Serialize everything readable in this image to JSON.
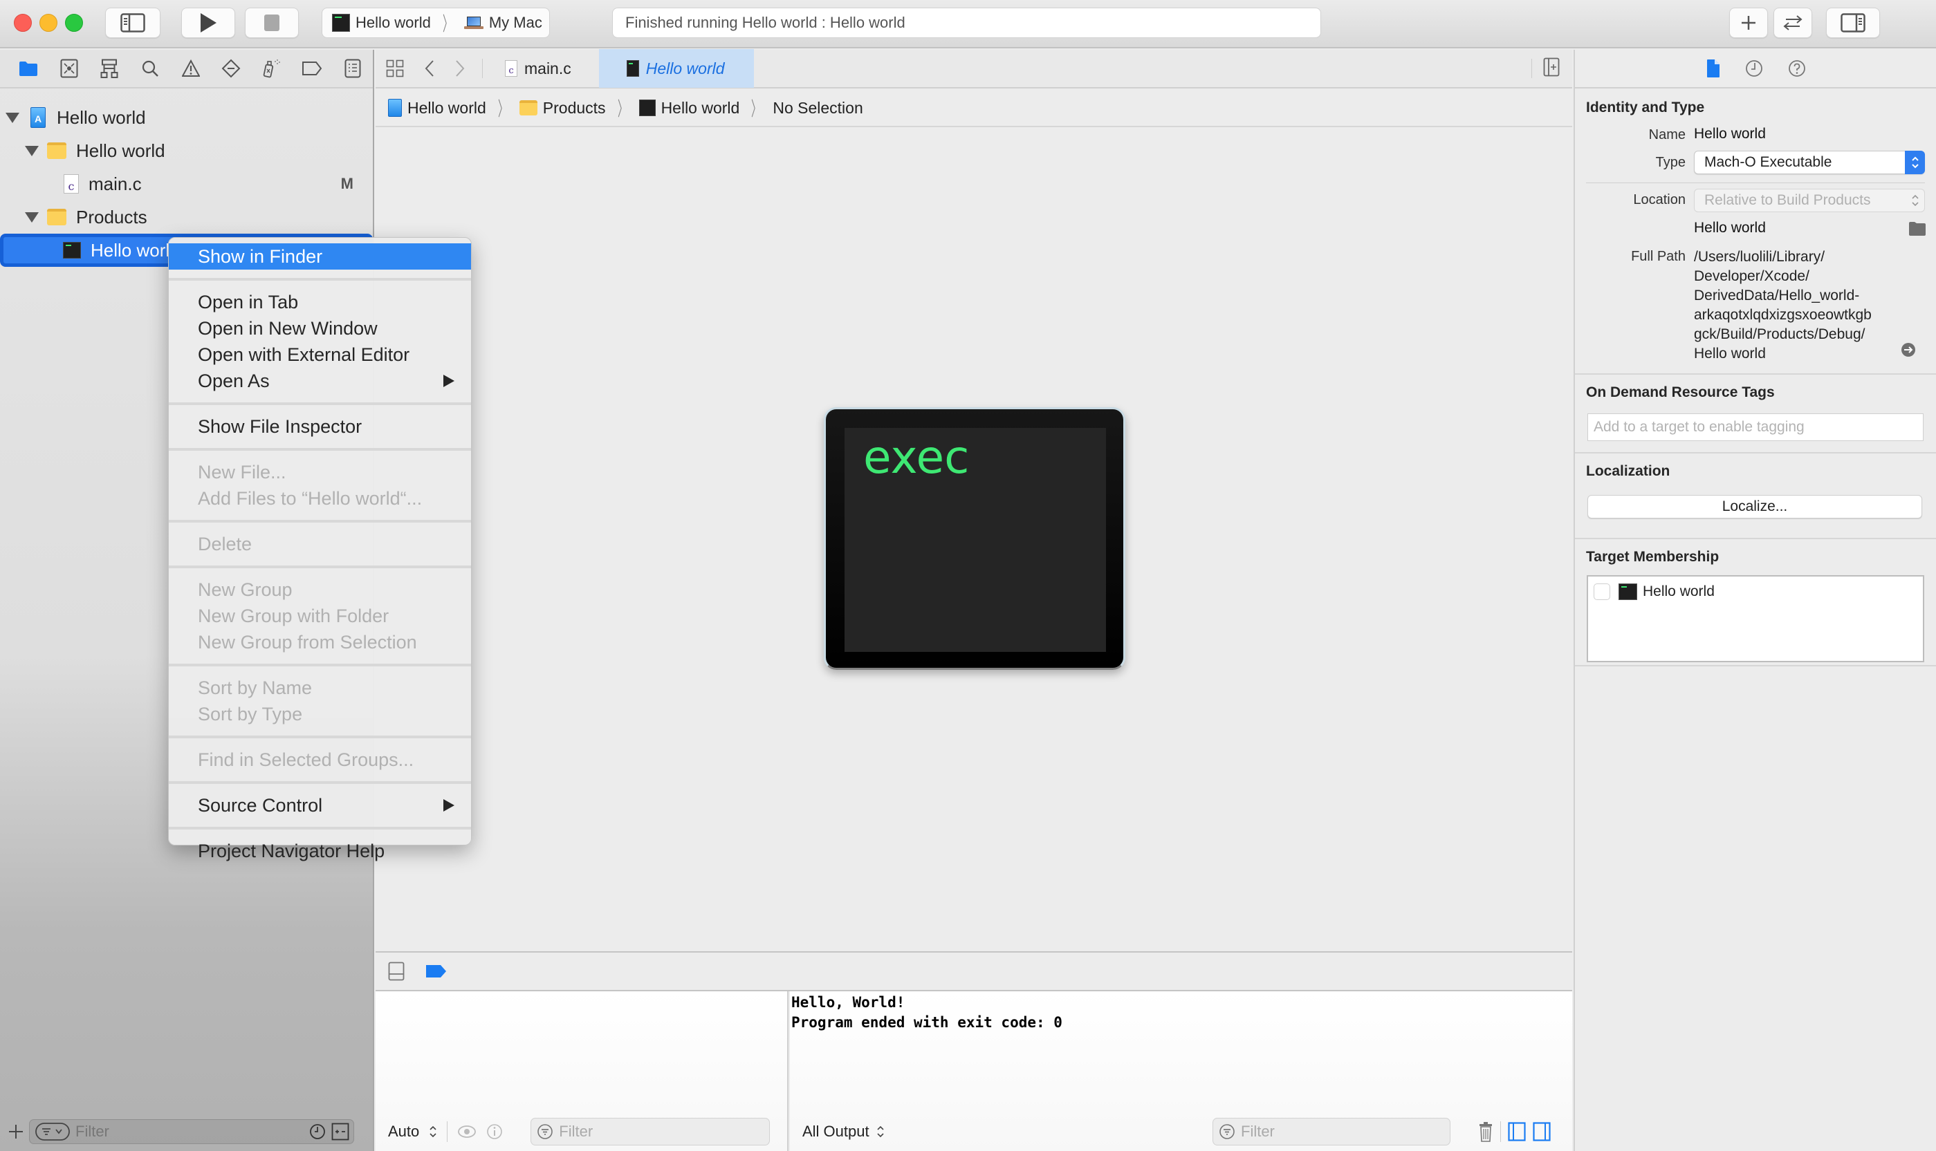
{
  "toolbar": {
    "scheme_target": "Hello world",
    "scheme_device": "My Mac",
    "activity_status": "Finished running Hello world : Hello world"
  },
  "navigator": {
    "tree": [
      {
        "label": "Hello world",
        "kind": "project",
        "level": 0,
        "expanded": true
      },
      {
        "label": "Hello world",
        "kind": "folder",
        "level": 1,
        "expanded": true
      },
      {
        "label": "main.c",
        "kind": "c-file",
        "level": 2,
        "badge": "M"
      },
      {
        "label": "Products",
        "kind": "folder",
        "level": 1,
        "expanded": true
      },
      {
        "label": "Hello world",
        "kind": "executable",
        "level": 2,
        "selected": true
      }
    ],
    "filter_placeholder": "Filter"
  },
  "editor": {
    "tabs": [
      {
        "label": "main.c",
        "active": false
      },
      {
        "label": "Hello world",
        "active": true
      }
    ],
    "breadcrumb": [
      "Hello world",
      "Products",
      "Hello world",
      "No Selection"
    ],
    "preview_icon_text": "exec"
  },
  "context_menu": {
    "groups": [
      [
        {
          "label": "Show in Finder",
          "enabled": true,
          "highlighted": true
        }
      ],
      [
        {
          "label": "Open in Tab",
          "enabled": true
        },
        {
          "label": "Open in New Window",
          "enabled": true
        },
        {
          "label": "Open with External Editor",
          "enabled": true
        },
        {
          "label": "Open As",
          "enabled": true,
          "submenu": true
        }
      ],
      [
        {
          "label": "Show File Inspector",
          "enabled": true
        }
      ],
      [
        {
          "label": "New File...",
          "enabled": false
        },
        {
          "label": "Add Files to “Hello world“...",
          "enabled": false
        }
      ],
      [
        {
          "label": "Delete",
          "enabled": false
        }
      ],
      [
        {
          "label": "New Group",
          "enabled": false
        },
        {
          "label": "New Group with Folder",
          "enabled": false
        },
        {
          "label": "New Group from Selection",
          "enabled": false
        }
      ],
      [
        {
          "label": "Sort by Name",
          "enabled": false
        },
        {
          "label": "Sort by Type",
          "enabled": false
        }
      ],
      [
        {
          "label": "Find in Selected Groups...",
          "enabled": false
        }
      ],
      [
        {
          "label": "Source Control",
          "enabled": true,
          "submenu": true
        }
      ],
      [
        {
          "label": "Project Navigator Help",
          "enabled": true
        }
      ]
    ]
  },
  "debug": {
    "console_lines": [
      "Hello, World!",
      "Program ended with exit code: 0"
    ],
    "variables_scope": "Auto",
    "variables_filter_placeholder": "Filter",
    "output_selector": "All Output",
    "console_filter_placeholder": "Filter"
  },
  "inspector": {
    "identity": {
      "title": "Identity and Type",
      "name_label": "Name",
      "name_value": "Hello world",
      "type_label": "Type",
      "type_value": "Mach-O Executable",
      "location_label": "Location",
      "location_value": "Relative to Build Products",
      "location_file": "Hello world",
      "full_path_label": "Full Path",
      "full_path_lines": [
        "/Users/luolili/Library/",
        "Developer/Xcode/",
        "DerivedData/Hello_world-",
        "arkaqotxlqdxizgsxoeowtkgb",
        "gck/Build/Products/Debug/",
        "Hello world"
      ]
    },
    "odr": {
      "title": "On Demand Resource Tags",
      "placeholder": "Add to a target to enable tagging"
    },
    "localization": {
      "title": "Localization",
      "button": "Localize..."
    },
    "target_membership": {
      "title": "Target Membership",
      "targets": [
        {
          "label": "Hello world",
          "checked": false
        }
      ]
    }
  },
  "colors": {
    "accent": "#2f7ef0",
    "exec_green": "#3ee873",
    "menu_highlight": "#2f87f2"
  }
}
